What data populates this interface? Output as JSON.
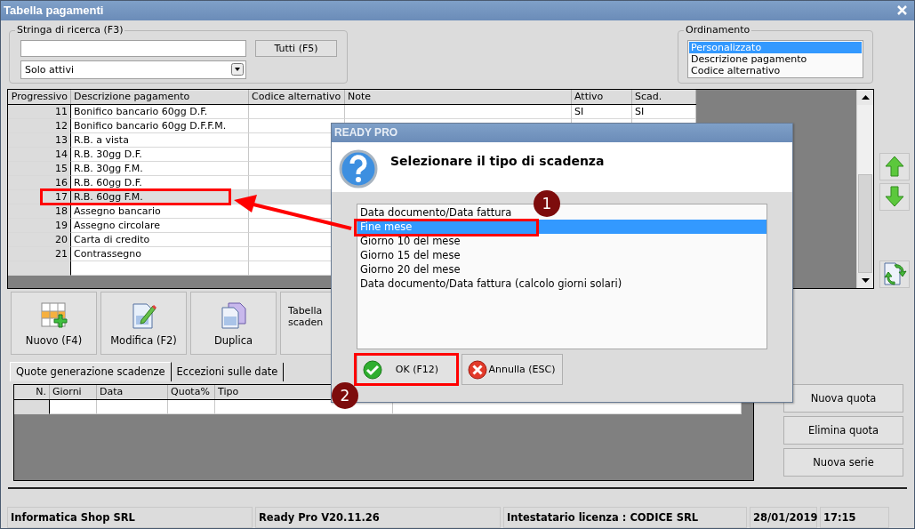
{
  "window": {
    "title": "Tabella pagamenti"
  },
  "search": {
    "label": "Stringa di ricerca (F3)",
    "button": "Tutti (F5)",
    "filter": "Solo attivi"
  },
  "ordering": {
    "label": "Ordinamento",
    "options": [
      {
        "label": "Personalizzato",
        "selected": true
      },
      {
        "label": "Descrizione pagamento",
        "selected": false
      },
      {
        "label": "Codice alternativo",
        "selected": false
      }
    ]
  },
  "table": {
    "columns": [
      "Progressivo",
      "Descrizione pagamento",
      "Codice alternativo",
      "Note",
      "Attivo",
      "Scad."
    ],
    "rows": [
      {
        "progressivo": "11",
        "descrizione": "Bonifico bancario 60gg D.F.",
        "attivo": "SI",
        "scad": "SI",
        "selected": false
      },
      {
        "progressivo": "12",
        "descrizione": "Bonifico bancario 60gg D.F.F.M.",
        "selected": false
      },
      {
        "progressivo": "13",
        "descrizione": "R.B. a vista",
        "selected": false
      },
      {
        "progressivo": "14",
        "descrizione": "R.B. 30gg D.F.",
        "selected": false
      },
      {
        "progressivo": "15",
        "descrizione": "R.B. 30gg F.M.",
        "selected": false
      },
      {
        "progressivo": "16",
        "descrizione": "R.B. 60gg D.F.",
        "selected": false
      },
      {
        "progressivo": "17",
        "descrizione": "R.B. 60gg F.M.",
        "selected": true
      },
      {
        "progressivo": "18",
        "descrizione": "Assegno bancario",
        "selected": false
      },
      {
        "progressivo": "19",
        "descrizione": "Assegno circolare",
        "selected": false
      },
      {
        "progressivo": "20",
        "descrizione": "Carta di credito",
        "selected": false
      },
      {
        "progressivo": "21",
        "descrizione": "Contrassegno",
        "selected": false
      }
    ]
  },
  "toolbar": [
    {
      "kind": "new",
      "lines": [
        "Nuovo (F4)"
      ]
    },
    {
      "kind": "edit",
      "lines": [
        "Modifica (F2)"
      ]
    },
    {
      "kind": "duplicate",
      "lines": [
        "Duplica"
      ]
    },
    {
      "kind": "text",
      "lines": [
        "Tabella",
        "scaden"
      ]
    }
  ],
  "tabs": [
    {
      "label": "Quote generazione scadenze",
      "selected": true
    },
    {
      "label": "Eccezioni sulle date",
      "selected": false
    }
  ],
  "quote_grid": {
    "columns": [
      "N.",
      "Giorni",
      "Data",
      "Quota%",
      "Tipo"
    ]
  },
  "side_buttons": [
    "Nuova quota",
    "Elimina quota",
    "Nuova serie"
  ],
  "status_bar": [
    "Informatica Shop SRL",
    "Ready Pro V20.11.26",
    "Intestatario licenza : CODICE SRL",
    "28/01/2019",
    "17:15"
  ],
  "dialog": {
    "title": "READY PRO",
    "heading": "Selezionare il tipo di scadenza",
    "options": [
      {
        "label": "Data documento/Data fattura",
        "selected": false
      },
      {
        "label": "Fine mese",
        "selected": true
      },
      {
        "label": "Giorno 10 del mese",
        "selected": false
      },
      {
        "label": "Giorno 15 del mese",
        "selected": false
      },
      {
        "label": "Giorno 20 del mese",
        "selected": false
      },
      {
        "label": "Data documento/Data fattura (calcolo giorni solari)",
        "selected": false
      }
    ],
    "buttons": [
      {
        "kind": "ok",
        "label": "OK (F12)"
      },
      {
        "kind": "cancel",
        "label": "Annulla (ESC)"
      }
    ]
  },
  "annotations": {
    "badges": [
      "1",
      "2"
    ]
  }
}
